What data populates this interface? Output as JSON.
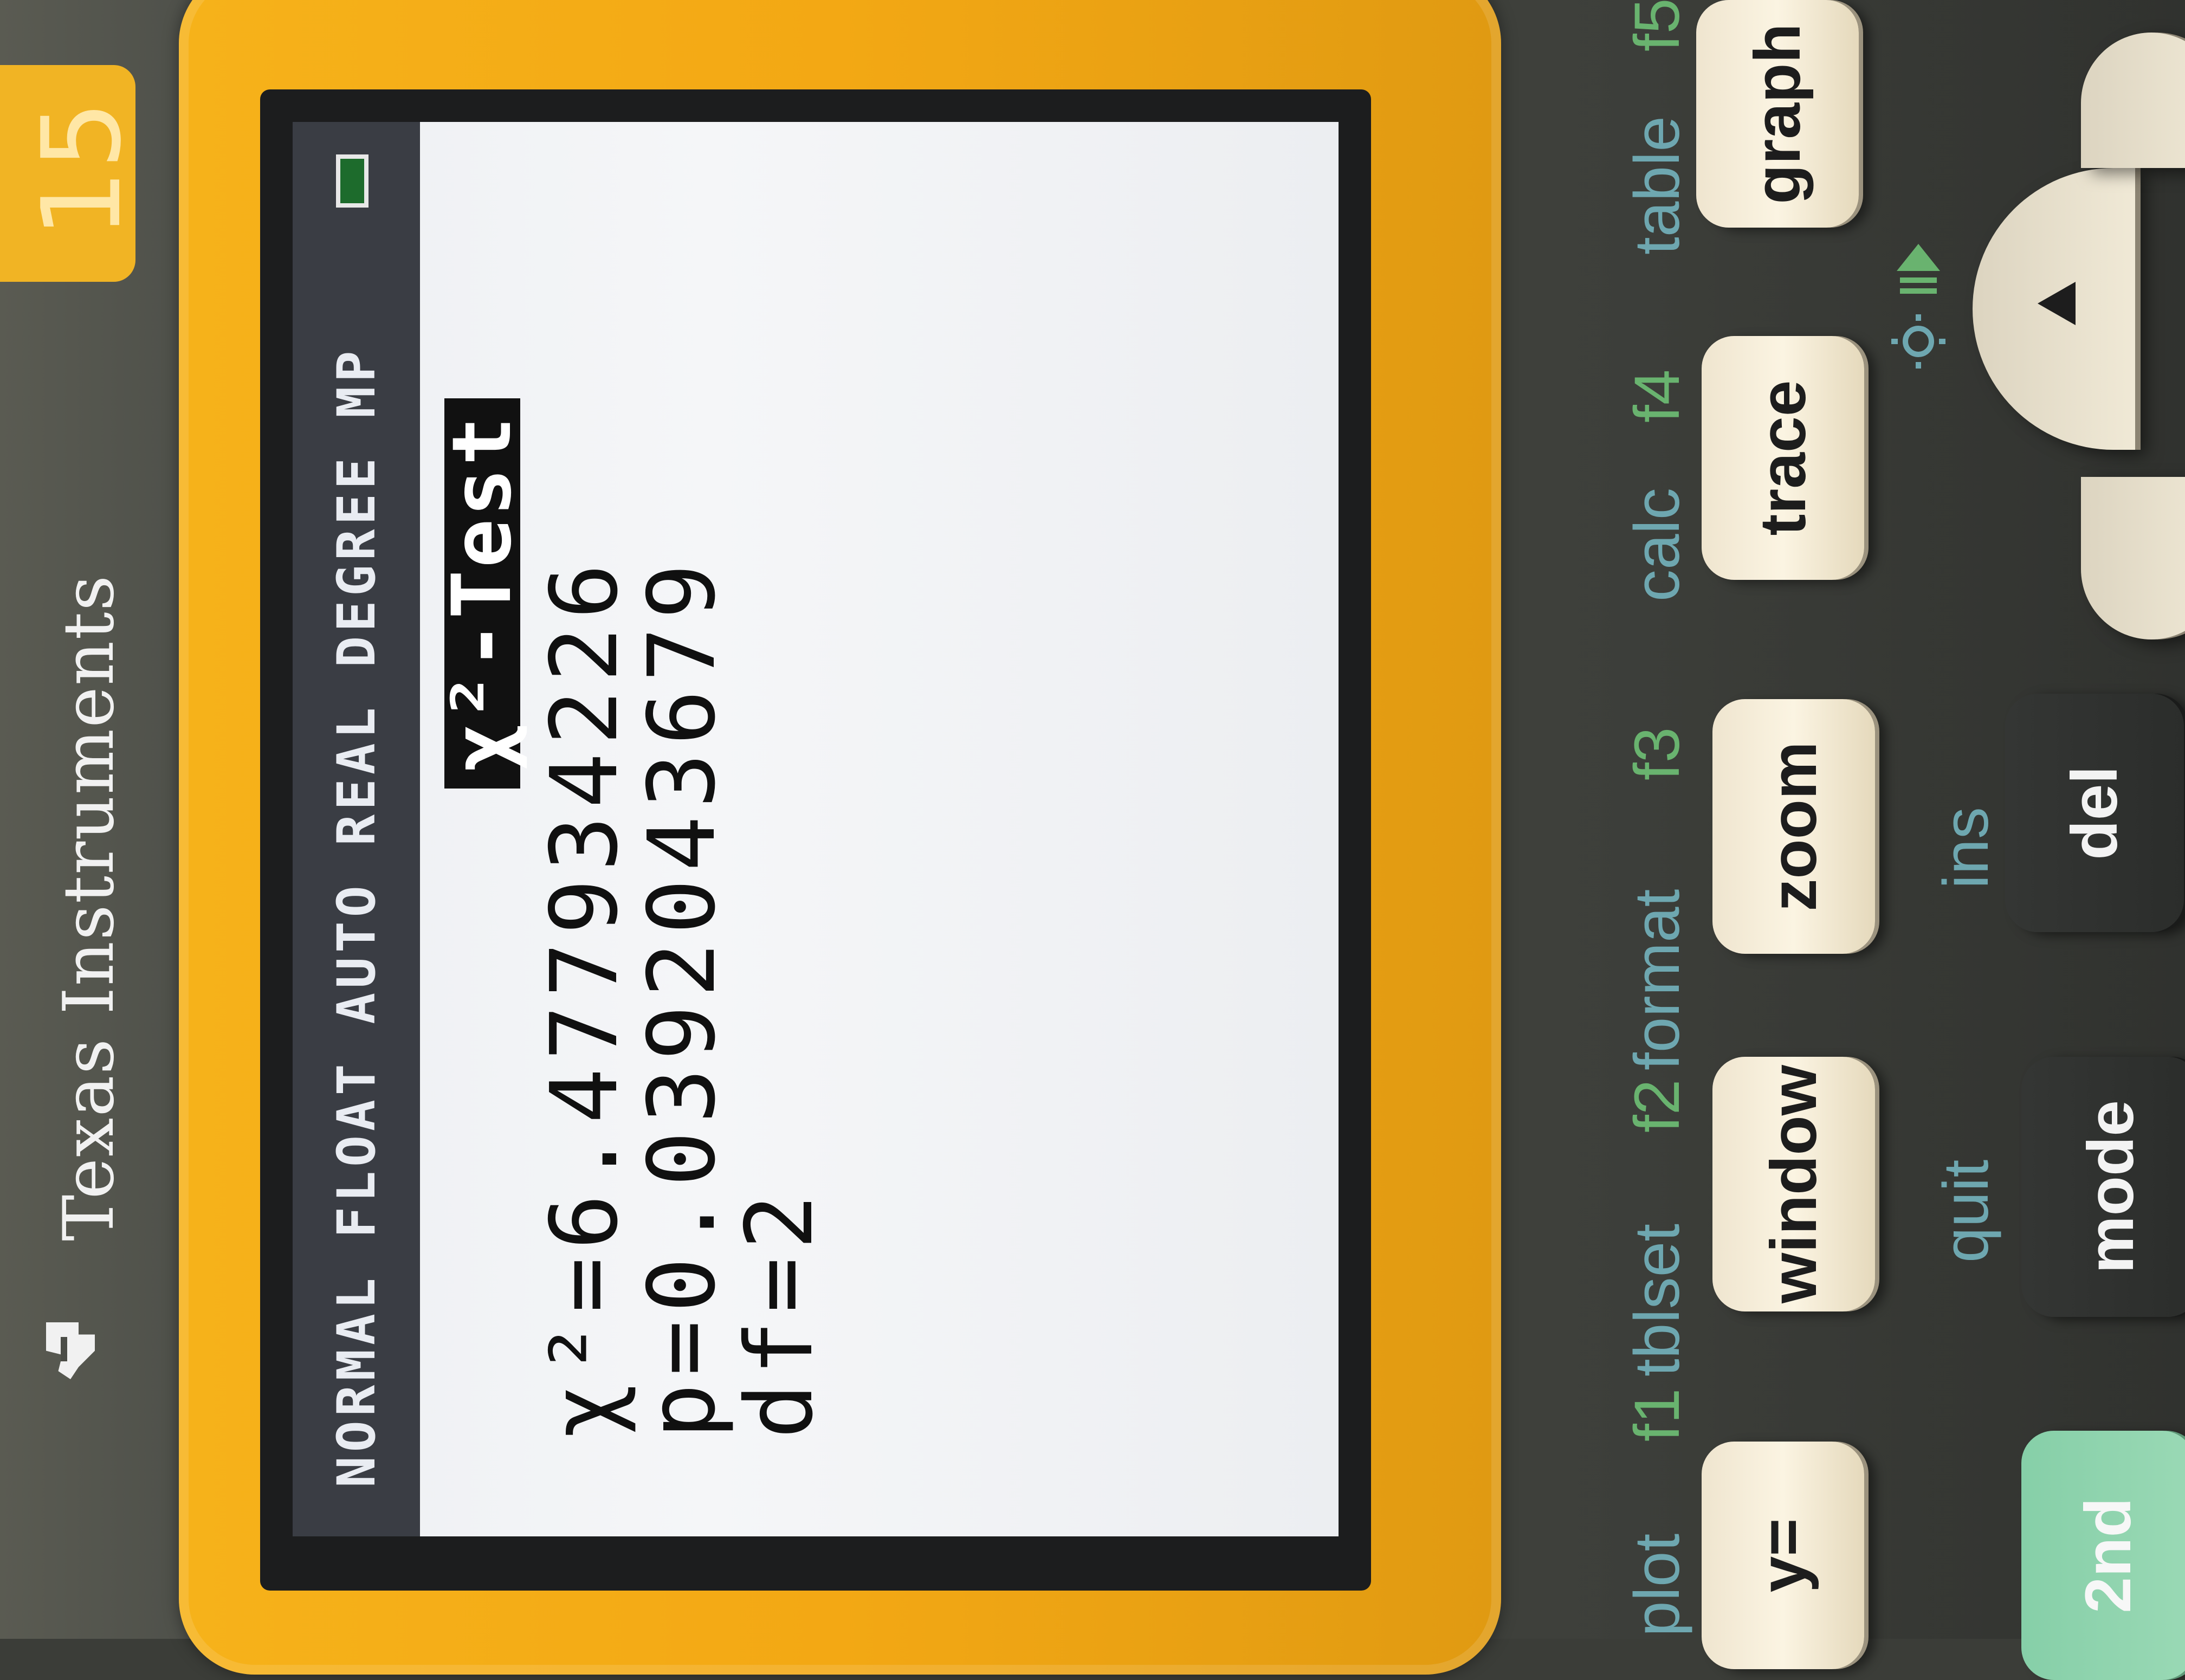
{
  "screen": {
    "status_bar": "NORMAL FLOAT AUTO REAL DEGREE MP",
    "title": "χ²-Test",
    "lines": [
      "χ²=6.477934226",
      "p=0.0392043679",
      "df=2"
    ]
  },
  "branding": {
    "maker": "Texas Instruments",
    "model_fragment": "15"
  },
  "keys": {
    "row1_function_labels": [
      {
        "text": "plot",
        "color": "teal"
      },
      {
        "text": "f1",
        "color": "green"
      },
      {
        "text": "tblset",
        "color": "teal"
      },
      {
        "text": "f2",
        "color": "green"
      },
      {
        "text": "format",
        "color": "teal"
      },
      {
        "text": "f3",
        "color": "green"
      },
      {
        "text": "calc",
        "color": "teal"
      },
      {
        "text": "f4",
        "color": "green"
      },
      {
        "text": "table",
        "color": "teal"
      },
      {
        "text": "f5",
        "color": "green"
      }
    ],
    "row1": [
      "y=",
      "window",
      "zoom",
      "trace",
      "graph"
    ],
    "row2_secondary": [
      "quit",
      "ins"
    ],
    "row2": [
      "2nd",
      "mode",
      "del"
    ]
  },
  "colors": {
    "bezel": "#f3a814",
    "status_bar": "#3a3d44",
    "teal_label": "#6ea7b0",
    "green_label": "#69b36f",
    "battery": "#1d6b2c"
  }
}
